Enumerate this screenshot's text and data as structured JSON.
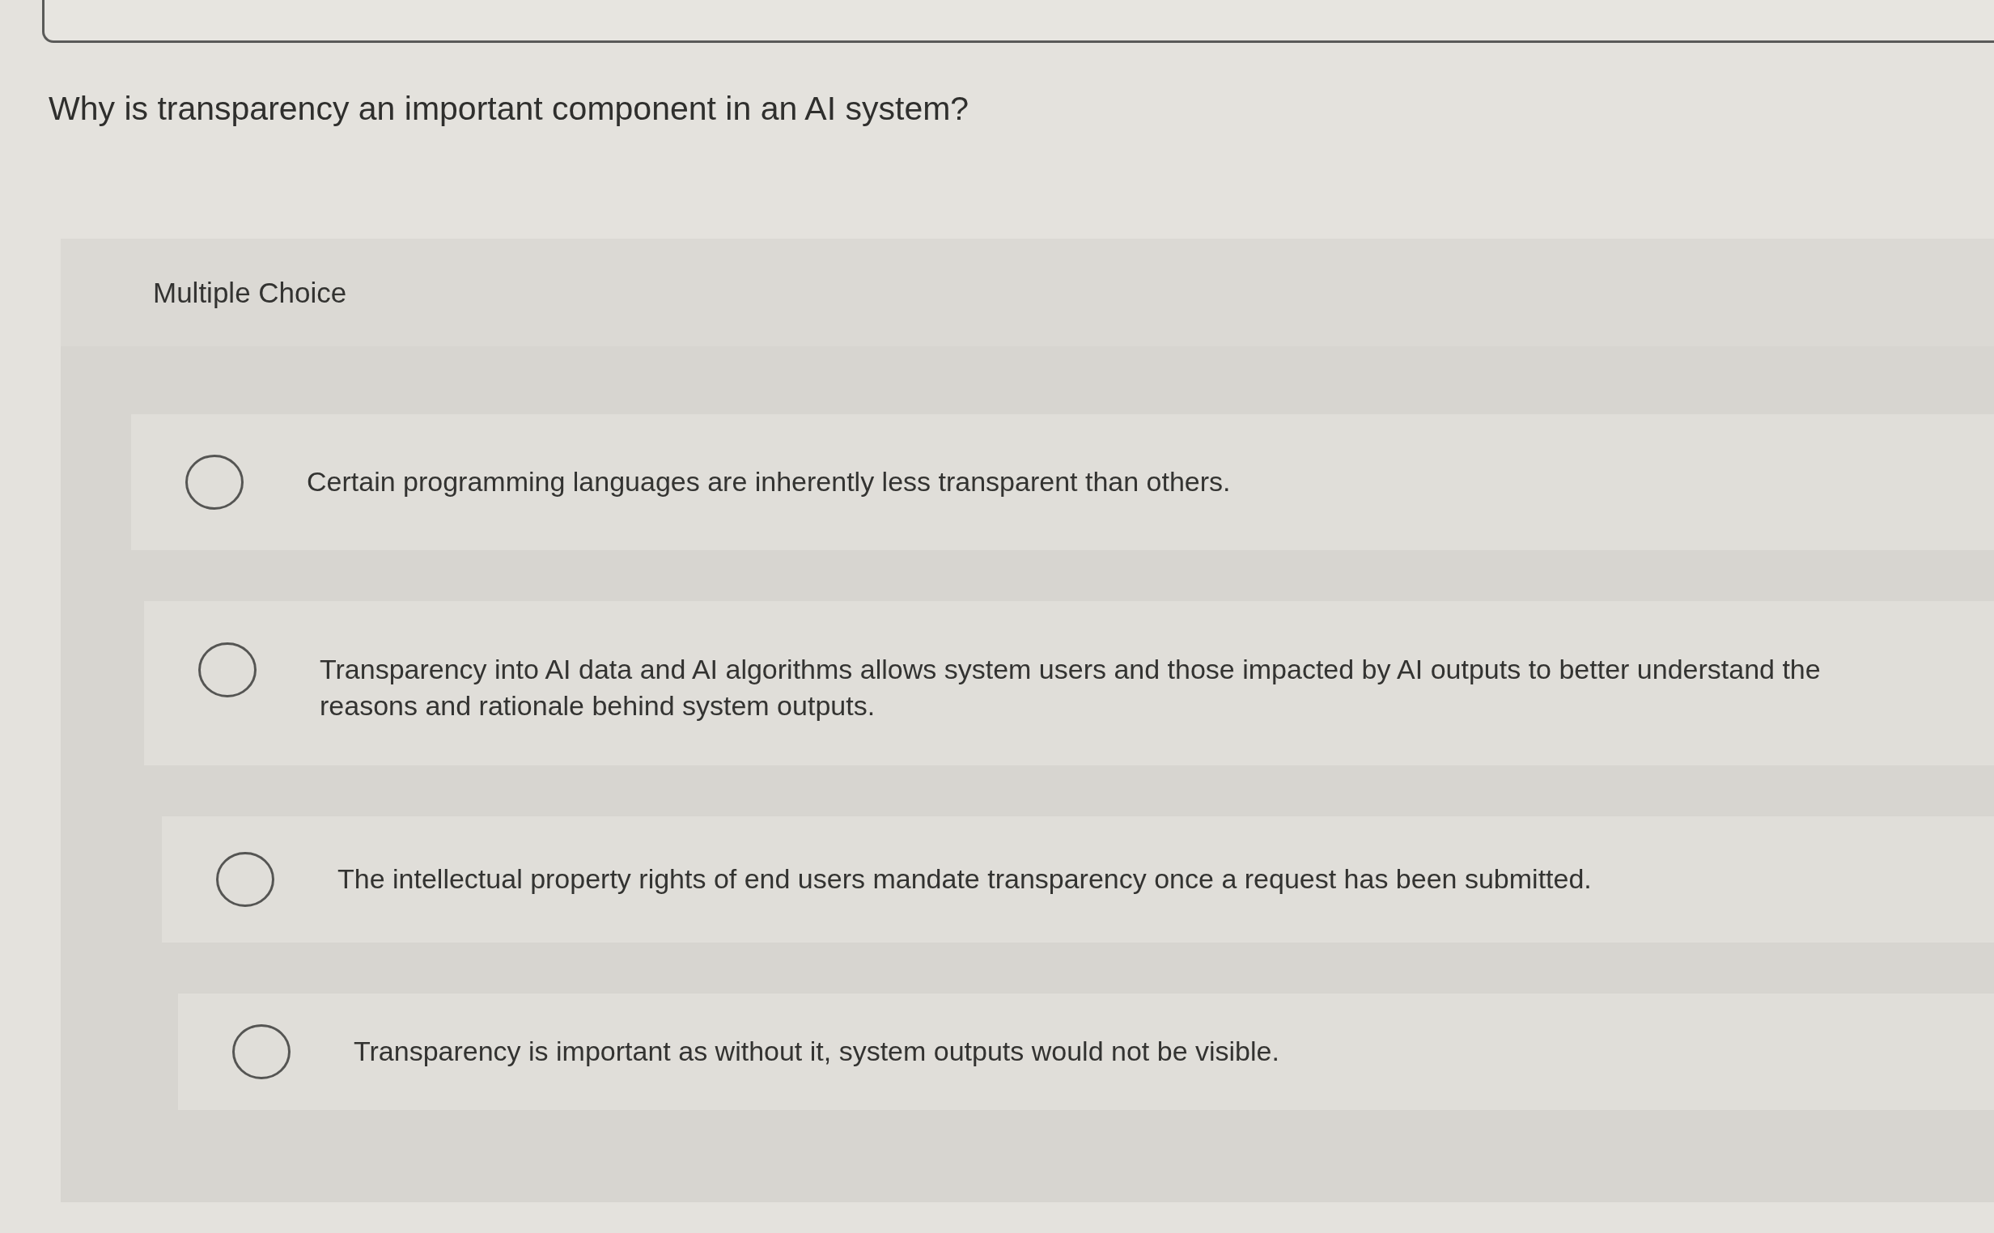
{
  "question": {
    "prompt": "Why is transparency an important component in an AI system?",
    "type_label": "Multiple Choice",
    "options": [
      {
        "text": "Certain programming languages are inherently less transparent than others.",
        "selected": false
      },
      {
        "text": "Transparency into AI data and AI algorithms allows system users and those impacted by AI outputs to better understand the reasons and rationale behind system outputs.",
        "selected": false
      },
      {
        "text": "The intellectual property rights of end users mandate transparency once a request has been submitted.",
        "selected": false
      },
      {
        "text": "Transparency is important as without it, system outputs would not be visible.",
        "selected": false
      }
    ]
  }
}
